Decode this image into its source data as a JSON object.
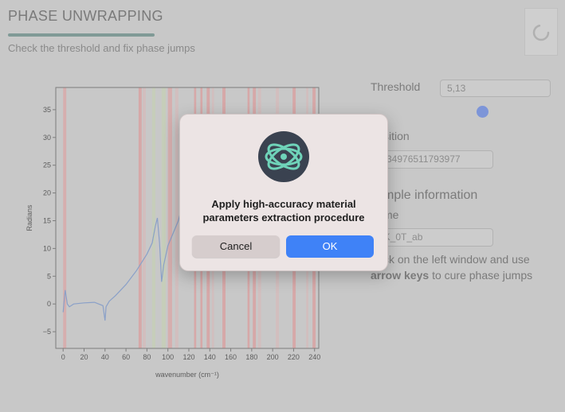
{
  "header": {
    "title": "PHASE UNWRAPPING",
    "subtitle": "Check the threshold and fix phase jumps"
  },
  "colors": {
    "background": "#c8c8c8",
    "accent_bar": "#809a96",
    "slider_dot": "#7d95d8",
    "ok_button": "#3f82f7"
  },
  "side_panel": {
    "threshold_label": "Threshold",
    "threshold_value": "5,13",
    "threshold_slider_value": 5.13,
    "position_label": "sition",
    "position_value": "1,34976511793977",
    "sample_info_label": "mple information",
    "name_label": "me",
    "name_value": "2K_0T_ab",
    "instructions": {
      "line1": "ck on the left window and use",
      "line2_bold": "arrow keys",
      "line2_rest": "to cure phase jumps"
    }
  },
  "dialog": {
    "icon": "atom-app-icon",
    "message_line1": "Apply high-accuracy material",
    "message_line2": "parameters extraction procedure",
    "cancel_label": "Cancel",
    "ok_label": "OK"
  },
  "chart_data": {
    "type": "line",
    "xlabel": "wavenumber (cm⁻¹)",
    "ylabel": "Radians",
    "xlim": [
      -7,
      244
    ],
    "ylim": [
      -8,
      39
    ],
    "xticks": [
      0,
      20,
      40,
      60,
      80,
      100,
      120,
      140,
      160,
      180,
      200,
      220,
      240
    ],
    "yticks": [
      -5,
      0,
      5,
      10,
      15,
      20,
      25,
      30,
      35
    ],
    "x": [
      0,
      2,
      4,
      6,
      10,
      20,
      30,
      38,
      40,
      41,
      44,
      50,
      60,
      70,
      80,
      85,
      88,
      90,
      92,
      94,
      96,
      100,
      110,
      118,
      122,
      126
    ],
    "series": [
      {
        "color": "#8aa0c8",
        "values": [
          -1.5,
          2.5,
          0,
          -0.5,
          0,
          0.2,
          0.3,
          -0.3,
          -3.0,
          -0.5,
          0.5,
          1.5,
          3.5,
          6.0,
          9.0,
          11.0,
          14.0,
          15.5,
          11.0,
          4.0,
          7.0,
          10.5,
          15.0,
          21.0,
          25.0,
          27.0
        ]
      }
    ],
    "highlight_bands": [
      {
        "from": 0,
        "to": 3,
        "color": "#d9a7a7"
      },
      {
        "from": 72,
        "to": 75,
        "color": "#d9a0a0"
      },
      {
        "from": 76,
        "to": 79,
        "color": "#d4bcbc"
      },
      {
        "from": 85,
        "to": 88,
        "color": "#c5cfb7"
      },
      {
        "from": 94,
        "to": 98,
        "color": "#c5cfb7"
      },
      {
        "from": 100,
        "to": 104,
        "color": "#d9a7a7"
      },
      {
        "from": 107,
        "to": 110,
        "color": "#d4bcbc"
      },
      {
        "from": 125,
        "to": 127,
        "color": "#d9a0a0"
      },
      {
        "from": 131,
        "to": 133,
        "color": "#d9a0a0"
      },
      {
        "from": 137,
        "to": 140,
        "color": "#d9a0a0"
      },
      {
        "from": 142,
        "to": 144,
        "color": "#d4bcbc"
      },
      {
        "from": 152,
        "to": 155,
        "color": "#d9a0a0"
      },
      {
        "from": 176,
        "to": 178,
        "color": "#d9a0a0"
      },
      {
        "from": 181,
        "to": 184,
        "color": "#d9a0a0"
      },
      {
        "from": 186,
        "to": 189,
        "color": "#d4bcbc"
      },
      {
        "from": 203,
        "to": 206,
        "color": "#d4bcbc"
      },
      {
        "from": 219,
        "to": 222,
        "color": "#d9a0a0"
      },
      {
        "from": 232,
        "to": 234,
        "color": "#d4bcbc"
      },
      {
        "from": 238,
        "to": 241,
        "color": "#d9a0a0"
      }
    ]
  }
}
